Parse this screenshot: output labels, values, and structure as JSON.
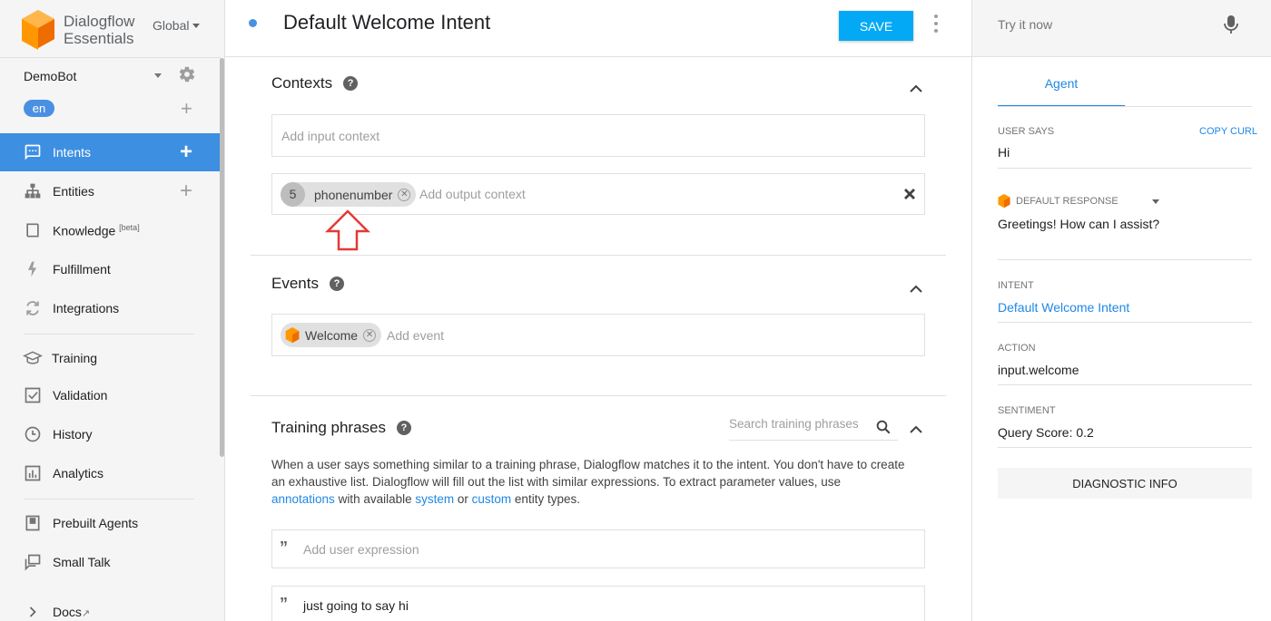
{
  "brand": {
    "line1": "Dialogflow",
    "line2": "Essentials",
    "region": "Global"
  },
  "agent": {
    "name": "DemoBot",
    "language": "en"
  },
  "nav": {
    "intents": "Intents",
    "entities": "Entities",
    "knowledge": "Knowledge",
    "knowledge_badge": "[beta]",
    "fulfillment": "Fulfillment",
    "integrations": "Integrations",
    "training": "Training",
    "validation": "Validation",
    "history": "History",
    "analytics": "Analytics",
    "prebuilt_agents": "Prebuilt Agents",
    "small_talk": "Small Talk",
    "docs": "Docs"
  },
  "header": {
    "intent_title": "Default Welcome Intent",
    "save_label": "SAVE"
  },
  "contexts": {
    "title": "Contexts",
    "input_placeholder": "Add input context",
    "output_context": {
      "lifespan": "5",
      "name": "phonenumber"
    },
    "output_placeholder": "Add output context"
  },
  "events": {
    "title": "Events",
    "event_chip": "Welcome",
    "placeholder": "Add event"
  },
  "training_phrases": {
    "title": "Training phrases",
    "search_placeholder": "Search training phrases",
    "desc_part1": "When a user says something similar to a training phrase, Dialogflow matches it to the intent. You don't have to create an exhaustive list. Dialogflow will fill out the list with similar expressions. To extract parameter values, use ",
    "desc_link_annotations": "annotations",
    "desc_part2": " with available ",
    "desc_link_system": "system",
    "desc_part3": " or ",
    "desc_link_custom": "custom",
    "desc_part4": " entity types.",
    "add_placeholder": "Add user expression",
    "phrases": [
      "just going to say hi"
    ]
  },
  "right_panel": {
    "try_placeholder": "Try it now",
    "tab_agent": "Agent",
    "user_says_label": "USER SAYS",
    "copy_curl": "COPY CURL",
    "user_says_value": "Hi",
    "default_response_label": "DEFAULT RESPONSE",
    "default_response_value": "Greetings! How can I assist?",
    "intent_label": "INTENT",
    "intent_value": "Default Welcome Intent",
    "action_label": "ACTION",
    "action_value": "input.welcome",
    "sentiment_label": "SENTIMENT",
    "sentiment_value": "Query Score: 0.2",
    "diagnostic_button": "DIAGNOSTIC INFO"
  },
  "colors": {
    "accent": "#3d8fe1",
    "save_button": "#03a9f4",
    "link": "#1e88e5",
    "logo_orange": "#f57c00",
    "annotation_arrow": "#e53935"
  },
  "icons": [
    "dialogflow-logo-icon",
    "gear-icon",
    "intents-icon",
    "entities-icon",
    "knowledge-icon",
    "fulfillment-icon",
    "integrations-icon",
    "training-icon",
    "validation-icon",
    "history-icon",
    "analytics-icon",
    "prebuilt-agents-icon",
    "small-talk-icon",
    "chevron-right-icon",
    "external-link-icon",
    "help-icon",
    "chevron-up-icon",
    "close-icon",
    "search-icon",
    "quote-icon",
    "microphone-icon",
    "kebab-menu-icon",
    "red-arrow-annotation-icon"
  ]
}
